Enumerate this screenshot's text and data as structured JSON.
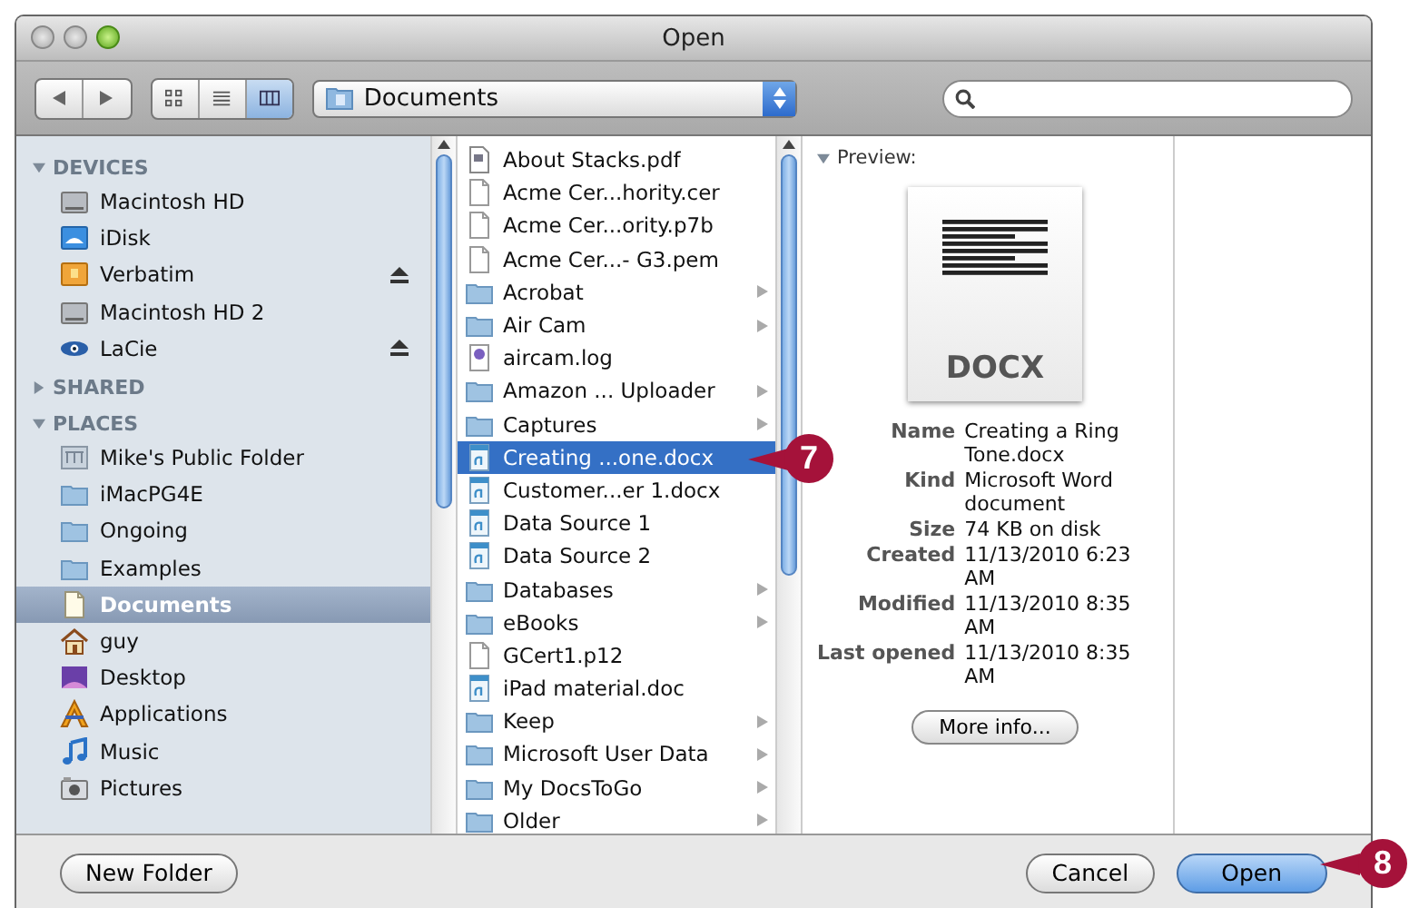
{
  "window": {
    "title": "Open"
  },
  "toolbar": {
    "views": [
      {
        "kind": "icons",
        "selected": false
      },
      {
        "kind": "list",
        "selected": false
      },
      {
        "kind": "columns",
        "selected": true
      }
    ],
    "location": "Documents"
  },
  "sidebar": {
    "sections": [
      {
        "label": "DEVICES",
        "expanded": true,
        "items": [
          {
            "label": "Macintosh HD",
            "kind": "disk",
            "eject": false,
            "selected": false
          },
          {
            "label": "iDisk",
            "kind": "idisk",
            "eject": false,
            "selected": false
          },
          {
            "label": "Verbatim",
            "kind": "usb",
            "eject": true,
            "selected": false
          },
          {
            "label": "Macintosh HD 2",
            "kind": "disk",
            "eject": false,
            "selected": false
          },
          {
            "label": "LaCie",
            "kind": "eye",
            "eject": true,
            "selected": false
          }
        ]
      },
      {
        "label": "SHARED",
        "expanded": false
      },
      {
        "label": "PLACES",
        "expanded": true,
        "items": [
          {
            "label": "Mike's Public Folder",
            "kind": "public",
            "eject": false,
            "selected": false
          },
          {
            "label": "iMacPG4E",
            "kind": "folder",
            "eject": false,
            "selected": false
          },
          {
            "label": "Ongoing",
            "kind": "folder",
            "eject": false,
            "selected": false
          },
          {
            "label": "Examples",
            "kind": "folder",
            "eject": false,
            "selected": false
          },
          {
            "label": "Documents",
            "kind": "docs",
            "eject": false,
            "selected": true
          },
          {
            "label": "guy",
            "kind": "home",
            "eject": false,
            "selected": false
          },
          {
            "label": "Desktop",
            "kind": "desktop",
            "eject": false,
            "selected": false
          },
          {
            "label": "Applications",
            "kind": "apps",
            "eject": false,
            "selected": false
          },
          {
            "label": "Music",
            "kind": "music",
            "eject": false,
            "selected": false
          },
          {
            "label": "Pictures",
            "kind": "camera",
            "eject": false,
            "selected": false
          }
        ]
      }
    ]
  },
  "files": [
    {
      "name": "About Stacks.pdf",
      "kind": "pdf",
      "selected": false
    },
    {
      "name": "Acme Cer...hority.cer",
      "kind": "file",
      "selected": false
    },
    {
      "name": "Acme Cer...ority.p7b",
      "kind": "file",
      "selected": false
    },
    {
      "name": "Acme Cer...- G3.pem",
      "kind": "file",
      "selected": false
    },
    {
      "name": "Acrobat",
      "kind": "folder",
      "selected": false
    },
    {
      "name": "Air Cam",
      "kind": "folder",
      "selected": false
    },
    {
      "name": "aircam.log",
      "kind": "log",
      "selected": false
    },
    {
      "name": "Amazon ... Uploader",
      "kind": "folder",
      "selected": false
    },
    {
      "name": "Captures",
      "kind": "folder",
      "selected": false
    },
    {
      "name": "Creating ...one.docx",
      "kind": "word",
      "selected": true
    },
    {
      "name": "Customer...er 1.docx",
      "kind": "word",
      "selected": false
    },
    {
      "name": "Data Source 1",
      "kind": "word",
      "selected": false
    },
    {
      "name": "Data Source 2",
      "kind": "word",
      "selected": false
    },
    {
      "name": "Databases",
      "kind": "folder",
      "selected": false
    },
    {
      "name": "eBooks",
      "kind": "folder",
      "selected": false
    },
    {
      "name": "GCert1.p12",
      "kind": "file",
      "selected": false
    },
    {
      "name": "iPad material.doc",
      "kind": "word",
      "selected": false
    },
    {
      "name": "Keep",
      "kind": "folder",
      "selected": false
    },
    {
      "name": "Microsoft User Data",
      "kind": "folder",
      "selected": false
    },
    {
      "name": "My DocsToGo",
      "kind": "folder",
      "selected": false
    },
    {
      "name": "Older",
      "kind": "folder",
      "selected": false
    }
  ],
  "preview": {
    "heading": "Preview:",
    "expanded": true,
    "badge": "DOCX",
    "details": [
      {
        "label": "Name",
        "value": "Creating a Ring Tone.docx"
      },
      {
        "label": "Kind",
        "value": "Microsoft Word document"
      },
      {
        "label": "Size",
        "value": "74 KB on disk"
      },
      {
        "label": "Created",
        "value": "11/13/2010 6:23 AM"
      },
      {
        "label": "Modified",
        "value": "11/13/2010 8:35 AM"
      },
      {
        "label": "Last opened",
        "value": "11/13/2010 8:35 AM"
      }
    ],
    "button": "More info..."
  },
  "buttons": [
    {
      "label": "New Folder",
      "kind": "plain"
    },
    {
      "label": "Cancel",
      "kind": "plain"
    },
    {
      "label": "Open",
      "kind": "default"
    }
  ],
  "callouts": [
    {
      "number": "7"
    },
    {
      "number": "8"
    }
  ]
}
